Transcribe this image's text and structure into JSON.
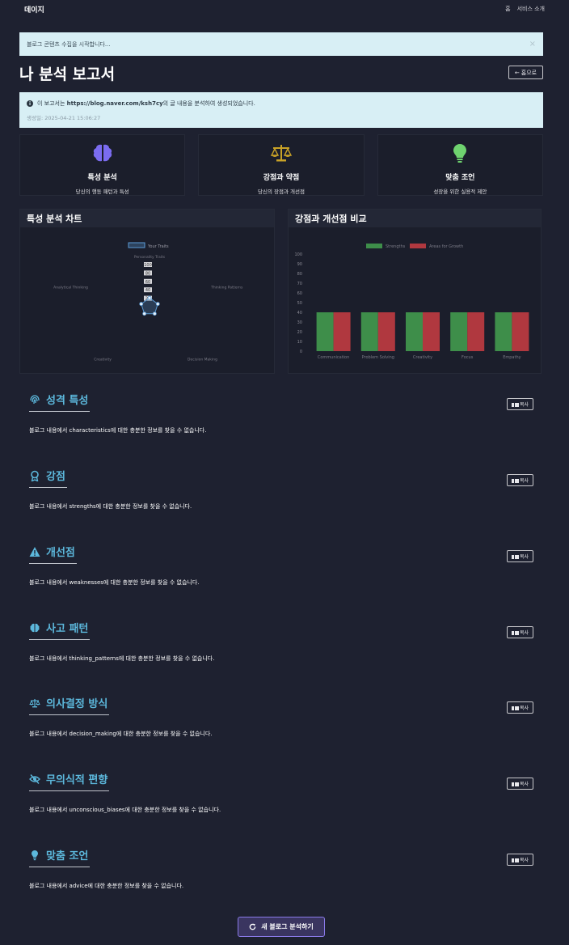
{
  "nav": {
    "brand": "데이지",
    "home": "홈",
    "about": "서비스 소개"
  },
  "alert": {
    "message": "블로그 콘텐츠 수집을 시작합니다...",
    "close": "×"
  },
  "title": "나 분석 보고서",
  "home_button": "홈으로",
  "info": {
    "prefix": "이 보고서는",
    "url": "https://blog.naver.com/ksh7cy",
    "suffix": "의 글 내용을 분석하여 생성되었습니다.",
    "date": "생성일: 2025-04-21 15:06:27"
  },
  "features": [
    {
      "title": "특성 분석",
      "desc": "당신의 행동 패턴과 특성",
      "icon": "brain-icon",
      "color": "#7b6cf0"
    },
    {
      "title": "강점과 약점",
      "desc": "당신의 장점과 개선점",
      "icon": "balance-scale-icon",
      "color": "#c9a227"
    },
    {
      "title": "맞춤 조언",
      "desc": "성장을 위한 실용적 제안",
      "icon": "lightbulb-icon",
      "color": "#6fd36f"
    }
  ],
  "radar_panel_title": "특성 분석 차트",
  "bar_panel_title": "강점과 개선점 비교",
  "chart_data": [
    {
      "type": "radar",
      "title": "Personality Traits",
      "categories": [
        "Personality Traits",
        "Thinking Patterns",
        "Decision Making",
        "Creativity",
        "Analytical Thinking"
      ],
      "series": [
        {
          "name": "Your Traits",
          "values": [
            20,
            20,
            20,
            20,
            20
          ],
          "color": "#5b9bd5"
        }
      ],
      "ticks": [
        20,
        40,
        60,
        80,
        100
      ],
      "range": [
        0,
        100
      ]
    },
    {
      "type": "bar",
      "categories": [
        "Communication",
        "Problem Solving",
        "Creativity",
        "Focus",
        "Empathy"
      ],
      "series": [
        {
          "name": "Strengths",
          "values": [
            40,
            40,
            40,
            40,
            40
          ],
          "color": "#3e8e4a"
        },
        {
          "name": "Areas for Growth",
          "values": [
            40,
            40,
            40,
            40,
            40
          ],
          "color": "#b0383f"
        }
      ],
      "yticks": [
        0,
        10,
        20,
        30,
        40,
        50,
        60,
        70,
        80,
        90,
        100
      ],
      "ylim": [
        0,
        100
      ]
    }
  ],
  "copy_label": "복사",
  "sections": [
    {
      "title": "성격 특성",
      "icon": "fingerprint-icon",
      "body": "블로그 내용에서 characteristics에 대한 충분한 정보를 찾을 수 없습니다."
    },
    {
      "title": "강점",
      "icon": "award-icon",
      "body": "블로그 내용에서 strengths에 대한 충분한 정보를 찾을 수 없습니다."
    },
    {
      "title": "개선점",
      "icon": "warning-icon",
      "body": "블로그 내용에서 weaknesses에 대한 충분한 정보를 찾을 수 없습니다."
    },
    {
      "title": "사고 패턴",
      "icon": "brain-icon",
      "body": "블로그 내용에서 thinking_patterns에 대한 충분한 정보를 찾을 수 없습니다."
    },
    {
      "title": "의사결정 방식",
      "icon": "balance-scale-icon",
      "body": "블로그 내용에서 decision_making에 대한 충분한 정보를 찾을 수 없습니다."
    },
    {
      "title": "무의식적 편향",
      "icon": "eye-slash-icon",
      "body": "블로그 내용에서 unconscious_biases에 대한 충분한 정보를 찾을 수 없습니다."
    },
    {
      "title": "맞춤 조언",
      "icon": "lightbulb-icon",
      "body": "블로그 내용에서 advice에 대한 충분한 정보를 찾을 수 없습니다."
    }
  ],
  "new_analysis_button": "새 블로그 분석하기"
}
